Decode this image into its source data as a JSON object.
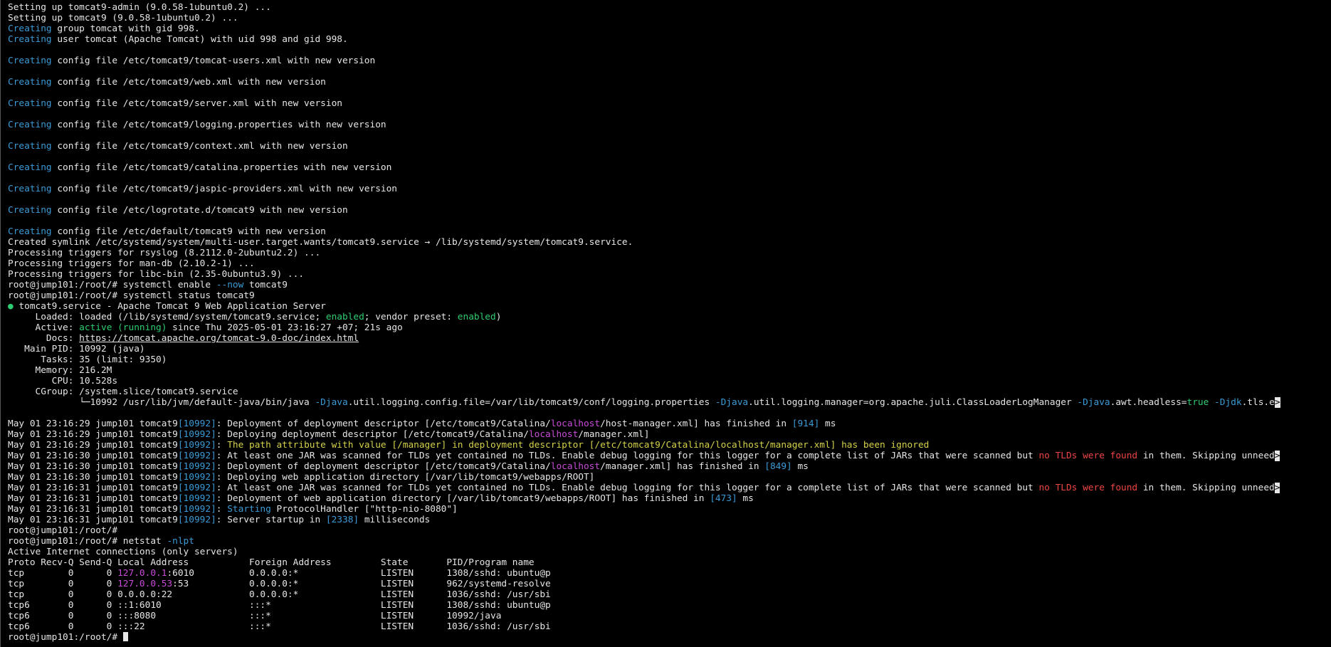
{
  "terminal": {
    "colors": {
      "background": "#000000",
      "default": "#e6e6e6",
      "cyan": "#3b9bd6",
      "green": "#2ecc71",
      "red": "#ee4444",
      "yellow": "#d4d24a",
      "magenta": "#c84bd8"
    },
    "lines": [
      [
        {
          "t": "Setting up tomcat9-admin (9.0.58-1ubuntu0.2) ..."
        }
      ],
      [
        {
          "t": "Setting up tomcat9 (9.0.58-1ubuntu0.2) ..."
        }
      ],
      [
        {
          "t": "Creating",
          "c": "cyan"
        },
        {
          "t": " group tomcat with gid 998."
        }
      ],
      [
        {
          "t": "Creating",
          "c": "cyan"
        },
        {
          "t": " user tomcat (Apache Tomcat) with uid 998 and gid 998."
        }
      ],
      [
        {
          "t": ""
        }
      ],
      [
        {
          "t": "Creating",
          "c": "cyan"
        },
        {
          "t": " config file /etc/tomcat9/tomcat-users.xml with new version"
        }
      ],
      [
        {
          "t": ""
        }
      ],
      [
        {
          "t": "Creating",
          "c": "cyan"
        },
        {
          "t": " config file /etc/tomcat9/web.xml with new version"
        }
      ],
      [
        {
          "t": ""
        }
      ],
      [
        {
          "t": "Creating",
          "c": "cyan"
        },
        {
          "t": " config file /etc/tomcat9/server.xml with new version"
        }
      ],
      [
        {
          "t": ""
        }
      ],
      [
        {
          "t": "Creating",
          "c": "cyan"
        },
        {
          "t": " config file /etc/tomcat9/logging.properties with new version"
        }
      ],
      [
        {
          "t": ""
        }
      ],
      [
        {
          "t": "Creating",
          "c": "cyan"
        },
        {
          "t": " config file /etc/tomcat9/context.xml with new version"
        }
      ],
      [
        {
          "t": ""
        }
      ],
      [
        {
          "t": "Creating",
          "c": "cyan"
        },
        {
          "t": " config file /etc/tomcat9/catalina.properties with new version"
        }
      ],
      [
        {
          "t": ""
        }
      ],
      [
        {
          "t": "Creating",
          "c": "cyan"
        },
        {
          "t": " config file /etc/tomcat9/jaspic-providers.xml with new version"
        }
      ],
      [
        {
          "t": ""
        }
      ],
      [
        {
          "t": "Creating",
          "c": "cyan"
        },
        {
          "t": " config file /etc/logrotate.d/tomcat9 with new version"
        }
      ],
      [
        {
          "t": ""
        }
      ],
      [
        {
          "t": "Creating",
          "c": "cyan"
        },
        {
          "t": " config file /etc/default/tomcat9 with new version"
        }
      ],
      [
        {
          "t": "Created symlink /etc/systemd/system/multi-user.target.wants/tomcat9.service → /lib/systemd/system/tomcat9.service."
        }
      ],
      [
        {
          "t": "Processing triggers for rsyslog (8.2112.0-2ubuntu2.2) ..."
        }
      ],
      [
        {
          "t": "Processing triggers for man-db (2.10.2-1) ..."
        }
      ],
      [
        {
          "t": "Processing triggers for libc-bin (2.35-0ubuntu3.9) ..."
        }
      ],
      [
        {
          "t": "root@jump101:/root/# systemctl enable "
        },
        {
          "t": "--now",
          "c": "cyan"
        },
        {
          "t": " tomcat9"
        }
      ],
      [
        {
          "t": "root@jump101:/root/# systemctl status tomcat9"
        }
      ],
      [
        {
          "t": "●",
          "c": "green"
        },
        {
          "t": " tomcat9.service - Apache Tomcat 9 Web Application Server"
        }
      ],
      [
        {
          "t": "     Loaded: loaded (/lib/systemd/system/tomcat9.service; "
        },
        {
          "t": "enabled",
          "c": "green"
        },
        {
          "t": "; vendor preset: "
        },
        {
          "t": "enabled",
          "c": "green"
        },
        {
          "t": ")"
        }
      ],
      [
        {
          "t": "     Active: "
        },
        {
          "t": "active (running)",
          "c": "green"
        },
        {
          "t": " since Thu 2025-05-01 23:16:27 +07; 21s ago"
        }
      ],
      [
        {
          "t": "       Docs: "
        },
        {
          "t": "https://tomcat.apache.org/tomcat-9.0-doc/index.html",
          "c": "under"
        }
      ],
      [
        {
          "t": "   Main PID: 10992 (java)"
        }
      ],
      [
        {
          "t": "      Tasks: 35 (limit: 9350)"
        }
      ],
      [
        {
          "t": "     Memory: 216.2M"
        }
      ],
      [
        {
          "t": "        CPU: 10.528s"
        }
      ],
      [
        {
          "t": "     CGroup: /system.slice/tomcat9.service"
        }
      ],
      [
        {
          "t": "             └─10992 /usr/lib/jvm/default-java/bin/java "
        },
        {
          "t": "-Djava",
          "c": "cyan"
        },
        {
          "t": ".util.logging.config.file=/var/lib/tomcat9/conf/logging.properties "
        },
        {
          "t": "-Djava",
          "c": "cyan"
        },
        {
          "t": ".util.logging.manager=org.apache.juli.ClassLoaderLogManager "
        },
        {
          "t": "-Djava",
          "c": "cyan"
        },
        {
          "t": ".awt.headless="
        },
        {
          "t": "true",
          "c": "green"
        },
        {
          "t": " "
        },
        {
          "t": "-Djdk",
          "c": "cyan"
        },
        {
          "t": ".tls.e"
        },
        {
          "t": ">",
          "c": "marker"
        }
      ],
      [
        {
          "t": ""
        }
      ],
      [
        {
          "t": "May 01 23:16:29 jump101 tomcat9"
        },
        {
          "t": "[10992]",
          "c": "cyan"
        },
        {
          "t": ": Deployment of deployment descriptor [/etc/tomcat9/Catalina/"
        },
        {
          "t": "localhost",
          "c": "magenta"
        },
        {
          "t": "/host-manager.xml] has finished in "
        },
        {
          "t": "[914]",
          "c": "cyan"
        },
        {
          "t": " ms"
        }
      ],
      [
        {
          "t": "May 01 23:16:29 jump101 tomcat9"
        },
        {
          "t": "[10992]",
          "c": "cyan"
        },
        {
          "t": ": Deploying deployment descriptor [/etc/tomcat9/Catalina/"
        },
        {
          "t": "localhost",
          "c": "magenta"
        },
        {
          "t": "/manager.xml]"
        }
      ],
      [
        {
          "t": "May 01 23:16:29 jump101 tomcat9"
        },
        {
          "t": "[10992]",
          "c": "cyan"
        },
        {
          "t": ": "
        },
        {
          "t": "The path attribute with value [/manager] in deployment descriptor [/etc/tomcat9/Catalina/localhost/manager.xml] has been ignored",
          "c": "yellow"
        }
      ],
      [
        {
          "t": "May 01 23:16:30 jump101 tomcat9"
        },
        {
          "t": "[10992]",
          "c": "cyan"
        },
        {
          "t": ": At least one JAR was scanned for TLDs yet contained no TLDs. Enable debug logging for this logger for a complete list of JARs that were scanned but "
        },
        {
          "t": "no TLDs were found",
          "c": "red"
        },
        {
          "t": " in them. Skipping unneed"
        },
        {
          "t": ">",
          "c": "marker"
        }
      ],
      [
        {
          "t": "May 01 23:16:30 jump101 tomcat9"
        },
        {
          "t": "[10992]",
          "c": "cyan"
        },
        {
          "t": ": Deployment of deployment descriptor [/etc/tomcat9/Catalina/"
        },
        {
          "t": "localhost",
          "c": "magenta"
        },
        {
          "t": "/manager.xml] has finished in "
        },
        {
          "t": "[849]",
          "c": "cyan"
        },
        {
          "t": " ms"
        }
      ],
      [
        {
          "t": "May 01 23:16:30 jump101 tomcat9"
        },
        {
          "t": "[10992]",
          "c": "cyan"
        },
        {
          "t": ": Deploying web application directory [/var/lib/tomcat9/webapps/ROOT]"
        }
      ],
      [
        {
          "t": "May 01 23:16:31 jump101 tomcat9"
        },
        {
          "t": "[10992]",
          "c": "cyan"
        },
        {
          "t": ": At least one JAR was scanned for TLDs yet contained no TLDs. Enable debug logging for this logger for a complete list of JARs that were scanned but "
        },
        {
          "t": "no TLDs were found",
          "c": "red"
        },
        {
          "t": " in them. Skipping unneed"
        },
        {
          "t": ">",
          "c": "marker"
        }
      ],
      [
        {
          "t": "May 01 23:16:31 jump101 tomcat9"
        },
        {
          "t": "[10992]",
          "c": "cyan"
        },
        {
          "t": ": Deployment of web application directory [/var/lib/tomcat9/webapps/ROOT] has finished in "
        },
        {
          "t": "[473]",
          "c": "cyan"
        },
        {
          "t": " ms"
        }
      ],
      [
        {
          "t": "May 01 23:16:31 jump101 tomcat9"
        },
        {
          "t": "[10992]",
          "c": "cyan"
        },
        {
          "t": ": "
        },
        {
          "t": "Starting",
          "c": "cyan"
        },
        {
          "t": " ProtocolHandler [\"http-nio-8080\"]"
        }
      ],
      [
        {
          "t": "May 01 23:16:31 jump101 tomcat9"
        },
        {
          "t": "[10992]",
          "c": "cyan"
        },
        {
          "t": ": Server startup in "
        },
        {
          "t": "[2338]",
          "c": "cyan"
        },
        {
          "t": " milliseconds"
        }
      ],
      [
        {
          "t": "root@jump101:/root/#"
        }
      ],
      [
        {
          "t": "root@jump101:/root/# netstat "
        },
        {
          "t": "-nlpt",
          "c": "cyan"
        }
      ],
      [
        {
          "t": "Active Internet connections (only servers)"
        }
      ],
      [
        {
          "t": "Proto Recv-Q Send-Q Local Address           Foreign Address         State       PID/Program name"
        }
      ],
      [
        {
          "t": "tcp        0      0 "
        },
        {
          "t": "127.0.0.1",
          "c": "magenta"
        },
        {
          "t": ":6010          0.0.0.0:*               LISTEN      1308/sshd: ubuntu@p"
        }
      ],
      [
        {
          "t": "tcp        0      0 "
        },
        {
          "t": "127.0.0.53",
          "c": "magenta"
        },
        {
          "t": ":53           0.0.0.0:*               LISTEN      962/systemd-resolve"
        }
      ],
      [
        {
          "t": "tcp        0      0 0.0.0.0:22              0.0.0.0:*               LISTEN      1036/sshd: /usr/sbi"
        }
      ],
      [
        {
          "t": "tcp6       0      0 ::1:6010                :::*                    LISTEN      1308/sshd: ubuntu@p"
        }
      ],
      [
        {
          "t": "tcp6       0      0 :::8080                 :::*                    LISTEN      10992/java"
        }
      ],
      [
        {
          "t": "tcp6       0      0 :::22                   :::*                    LISTEN      1036/sshd: /usr/sbi"
        }
      ],
      [
        {
          "t": "root@jump101:/root/# "
        },
        {
          "t": "",
          "c": "cursor"
        }
      ]
    ]
  }
}
